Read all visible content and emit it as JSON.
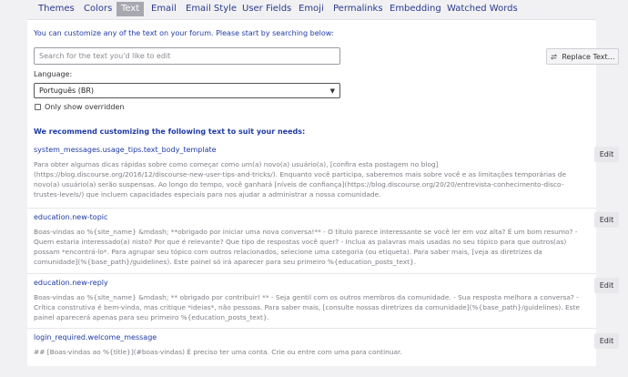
{
  "tabs": [
    {
      "label": "Themes"
    },
    {
      "label": "Colors"
    },
    {
      "label": "Text"
    },
    {
      "label": "Email"
    },
    {
      "label": "Email Style"
    },
    {
      "label": "User Fields"
    },
    {
      "label": "Emoji"
    },
    {
      "label": "Permalinks"
    },
    {
      "label": "Embedding"
    },
    {
      "label": "Watched Words"
    }
  ],
  "active_tab": "Text",
  "intro": "You can customize any of the text on your forum. Please start by searching below:",
  "search": {
    "placeholder": "Search for the text you'd like to edit",
    "value": ""
  },
  "replace_button": {
    "label": "Replace Text…",
    "icon": "exchange-icon"
  },
  "language": {
    "label": "Language:",
    "selected": "Português (BR)",
    "icon": "chevron-down-icon"
  },
  "only_overridden": {
    "label": "Only show overridden",
    "checked": false
  },
  "recommended_heading": "We recommend customizing the following text to suit your needs:",
  "entries": [
    {
      "key": "system_messages.usage_tips.text_body_template",
      "value": "Para obter algumas dicas rápidas sobre como começar como um(a) novo(a) usuário(a), [confira esta postagem no blog](https://blog.discourse.org/2016/12/discourse-new-user-tips-and-tricks/). Enquanto você participa, saberemos mais sobre você e as limitações temporárias de novo(a) usuário(a) serão suspensas. Ao longo do tempo, você ganhará [níveis de confiança](https://blog.discourse.org/20/20/entrevista-conhecimento-disco-trustes-levels/) que incluem capacidades especiais para nos ajudar a administrar a nossa comunidade.",
      "edit_label": "Edit"
    },
    {
      "key": "education.new-topic",
      "value": "Boas-vindas ao %{site_name} &mdash; **obrigado por iniciar uma nova conversa!** - O título parece interessante se você ler em voz alta? É um bom resumo? - Quem estaria interessado(a) nisto? Por que é relevante? Que tipo de respostas você quer? - Inclua as palavras mais usadas no seu tópico para que outros(as) possam *encontrá-lo*. Para agrupar seu tópico com outros relacionados, selecione uma categoria (ou etiqueta). Para saber mais, [veja as diretrizes da comunidade](%{base_path}/guidelines). Este painel só irá aparecer para seu primeiro %{education_posts_text}.",
      "edit_label": "Edit"
    },
    {
      "key": "education.new-reply",
      "value": "Boas-vindas ao %{site_name} &mdash; ** obrigado por contribuir! ** - Seja gentil com os outros membros da comunidade. - Sua resposta melhora a conversa? - Crítica construtiva é bem-vinda, mas critique *ideias*, não pessoas. Para saber mais, [consulte nossas diretrizes da comunidade](%{base_path}/guidelines). Este painel aparecerá apenas para seu primeiro %{education_posts_text}.",
      "edit_label": "Edit"
    },
    {
      "key": "login_required.welcome_message",
      "value": "## [Boas-vindas ao %{title}](#boas-vindas) É preciso ter uma conta. Crie ou entre com uma para continuar.",
      "edit_label": "Edit"
    }
  ],
  "colors": {
    "accent": "#1f3aa3",
    "active_tab_bg": "#a7a8b0",
    "muted_text": "#7e7e86"
  }
}
